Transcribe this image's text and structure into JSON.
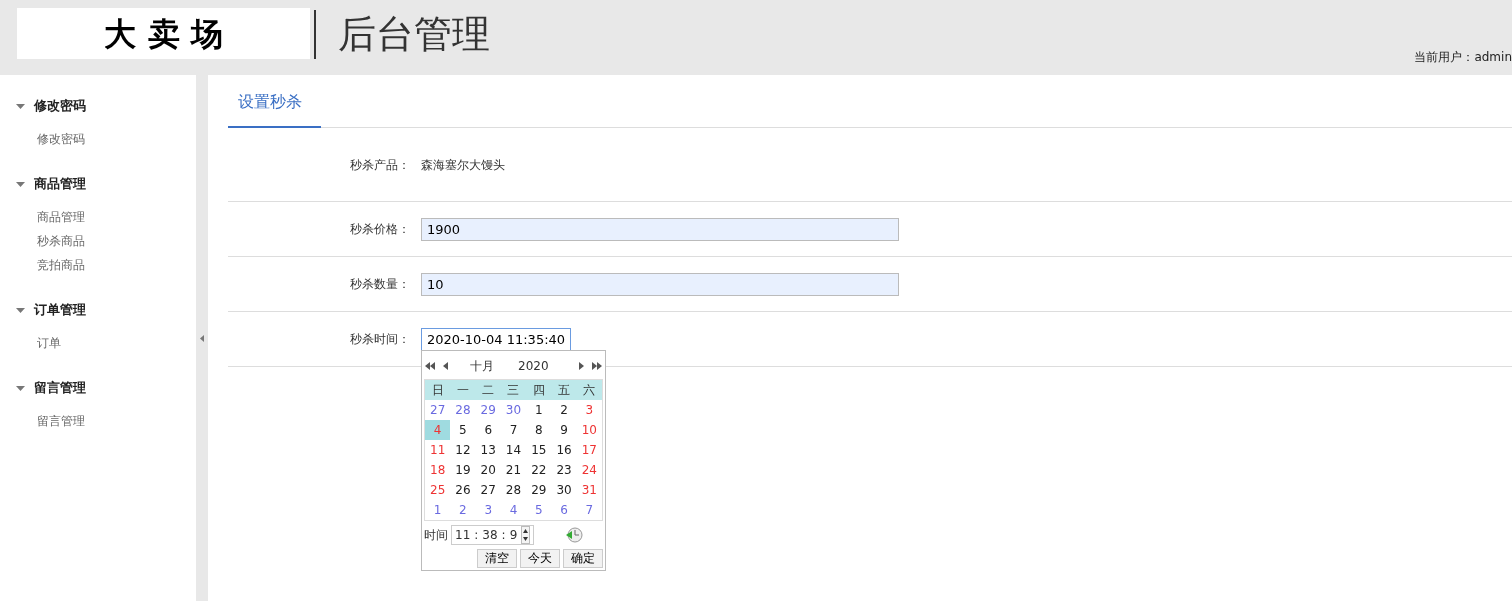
{
  "header": {
    "logo": "大 卖 场",
    "title": "后台管理",
    "user": "当前用户：admin"
  },
  "sidebar": [
    {
      "title": "修改密码",
      "expanded": true,
      "items": [
        "修改密码"
      ]
    },
    {
      "title": "商品管理",
      "expanded": true,
      "items": [
        "商品管理",
        "秒杀商品",
        "竞拍商品"
      ]
    },
    {
      "title": "订单管理",
      "expanded": true,
      "items": [
        "订单"
      ]
    },
    {
      "title": "留言管理",
      "expanded": true,
      "items": [
        "留言管理"
      ]
    }
  ],
  "tabs": [
    {
      "label": "设置秒杀",
      "selected": true
    }
  ],
  "form": [
    {
      "kind": "text",
      "label": "秒杀产品：",
      "value": "森海塞尔大馒头"
    },
    {
      "kind": "input",
      "label": "秒杀价格：",
      "value": "1900"
    },
    {
      "kind": "input",
      "label": "秒杀数量：",
      "value": "10"
    },
    {
      "kind": "date",
      "label": "秒杀时间：",
      "value": "2020-10-04 11:35:40"
    }
  ],
  "calendar": {
    "month": "十月",
    "year": "2020",
    "weekdays": [
      "日",
      "一",
      "二",
      "三",
      "四",
      "五",
      "六"
    ],
    "weeks": [
      [
        {
          "day": "27",
          "kind": "other",
          "selected": false
        },
        {
          "day": "28",
          "kind": "other",
          "selected": false
        },
        {
          "day": "29",
          "kind": "other",
          "selected": false
        },
        {
          "day": "30",
          "kind": "other",
          "selected": false
        },
        {
          "day": "1",
          "kind": "normal",
          "selected": false
        },
        {
          "day": "2",
          "kind": "normal",
          "selected": false
        },
        {
          "day": "3",
          "kind": "weekend",
          "selected": false
        }
      ],
      [
        {
          "day": "4",
          "kind": "weekend",
          "selected": true
        },
        {
          "day": "5",
          "kind": "normal",
          "selected": false
        },
        {
          "day": "6",
          "kind": "normal",
          "selected": false
        },
        {
          "day": "7",
          "kind": "normal",
          "selected": false
        },
        {
          "day": "8",
          "kind": "normal",
          "selected": false
        },
        {
          "day": "9",
          "kind": "normal",
          "selected": false
        },
        {
          "day": "10",
          "kind": "weekend",
          "selected": false
        }
      ],
      [
        {
          "day": "11",
          "kind": "weekend",
          "selected": false
        },
        {
          "day": "12",
          "kind": "normal",
          "selected": false
        },
        {
          "day": "13",
          "kind": "normal",
          "selected": false
        },
        {
          "day": "14",
          "kind": "normal",
          "selected": false
        },
        {
          "day": "15",
          "kind": "normal",
          "selected": false
        },
        {
          "day": "16",
          "kind": "normal",
          "selected": false
        },
        {
          "day": "17",
          "kind": "weekend",
          "selected": false
        }
      ],
      [
        {
          "day": "18",
          "kind": "weekend",
          "selected": false
        },
        {
          "day": "19",
          "kind": "normal",
          "selected": false
        },
        {
          "day": "20",
          "kind": "normal",
          "selected": false
        },
        {
          "day": "21",
          "kind": "normal",
          "selected": false
        },
        {
          "day": "22",
          "kind": "normal",
          "selected": false
        },
        {
          "day": "23",
          "kind": "normal",
          "selected": false
        },
        {
          "day": "24",
          "kind": "weekend",
          "selected": false
        }
      ],
      [
        {
          "day": "25",
          "kind": "weekend",
          "selected": false
        },
        {
          "day": "26",
          "kind": "normal",
          "selected": false
        },
        {
          "day": "27",
          "kind": "normal",
          "selected": false
        },
        {
          "day": "28",
          "kind": "normal",
          "selected": false
        },
        {
          "day": "29",
          "kind": "normal",
          "selected": false
        },
        {
          "day": "30",
          "kind": "normal",
          "selected": false
        },
        {
          "day": "31",
          "kind": "weekend",
          "selected": false
        }
      ],
      [
        {
          "day": "1",
          "kind": "other",
          "selected": false
        },
        {
          "day": "2",
          "kind": "other",
          "selected": false
        },
        {
          "day": "3",
          "kind": "other",
          "selected": false
        },
        {
          "day": "4",
          "kind": "other",
          "selected": false
        },
        {
          "day": "5",
          "kind": "other",
          "selected": false
        },
        {
          "day": "6",
          "kind": "other",
          "selected": false
        },
        {
          "day": "7",
          "kind": "other",
          "selected": false
        }
      ]
    ],
    "time_label": "时间",
    "hour": "11",
    "minute": "38",
    "second": "9",
    "separator": ":",
    "buttons": [
      "清空",
      "今天",
      "确定"
    ]
  }
}
